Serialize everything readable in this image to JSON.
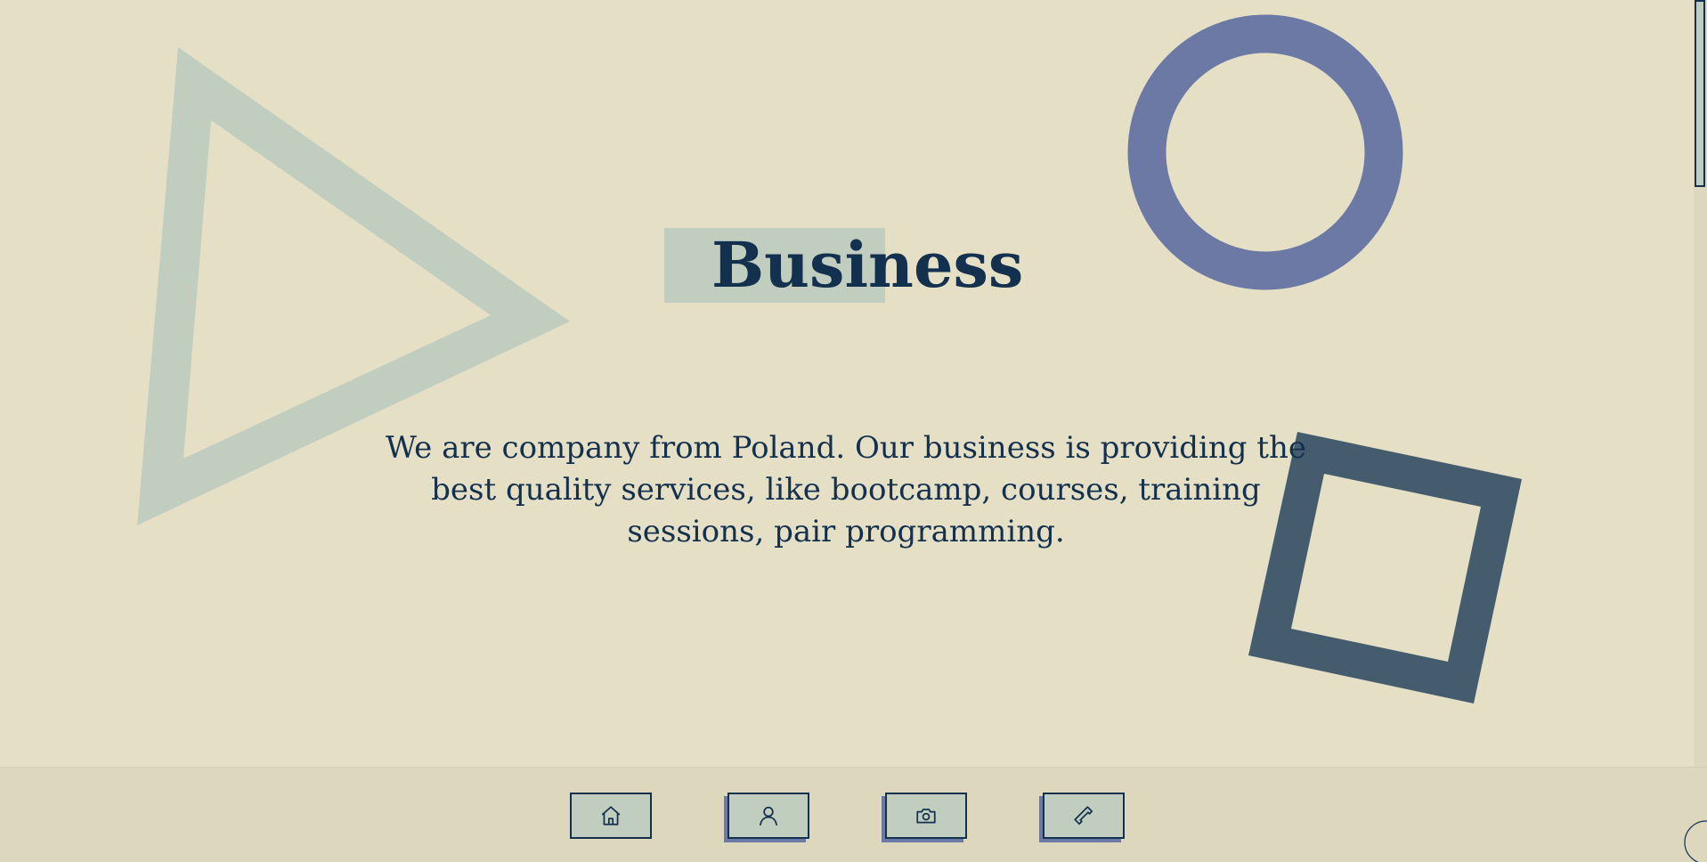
{
  "hero": {
    "title": "Business",
    "description": "We are company from Poland. Our business is providing the best quality services, like bootcamp, courses, training sessions, pair programming."
  },
  "nav": {
    "items": [
      {
        "icon": "home-icon"
      },
      {
        "icon": "user-icon"
      },
      {
        "icon": "camera-icon"
      },
      {
        "icon": "phone-icon"
      }
    ]
  },
  "colors": {
    "background": "#e5dfc5",
    "footer": "#ddd7be",
    "sage": "#c1cebf",
    "navy": "#13304e",
    "periwinkle": "#6b79a4",
    "slate": "#455c6e"
  }
}
